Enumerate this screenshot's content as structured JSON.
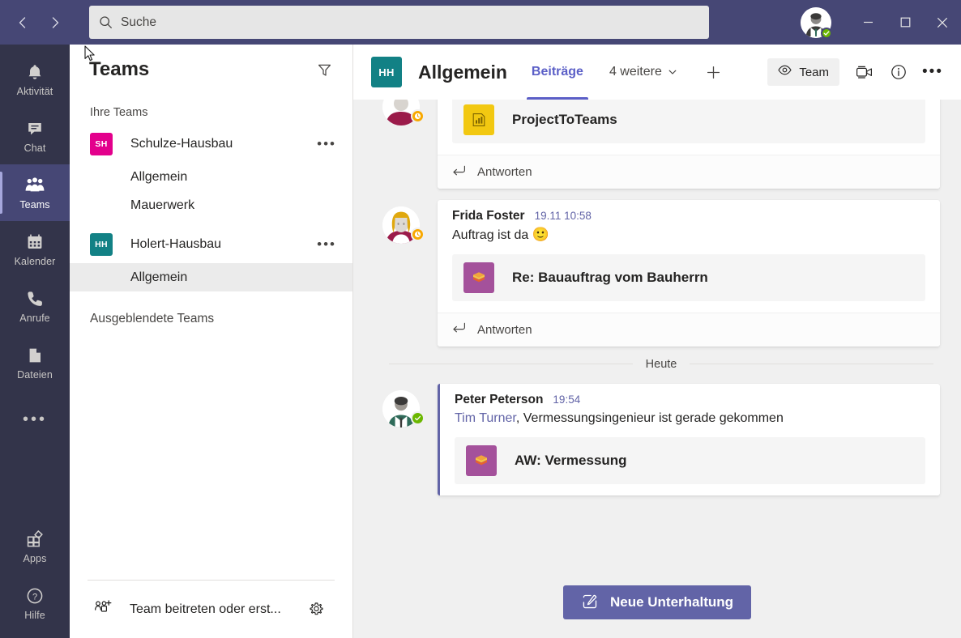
{
  "titlebar": {
    "back_label": "Zurück",
    "forward_label": "Vorwärts",
    "search_placeholder": "Suche",
    "search_value": "",
    "profile_status": "Verfügbar",
    "minimize_label": "Minimieren",
    "maximize_label": "Maximieren",
    "close_label": "Schließen"
  },
  "rail": {
    "items": [
      {
        "label": "Aktivität",
        "icon": "bell-icon",
        "active": false
      },
      {
        "label": "Chat",
        "icon": "chat-icon",
        "active": false
      },
      {
        "label": "Teams",
        "icon": "teams-icon",
        "active": true
      },
      {
        "label": "Kalender",
        "icon": "calendar-icon",
        "active": false
      },
      {
        "label": "Anrufe",
        "icon": "phone-icon",
        "active": false
      },
      {
        "label": "Dateien",
        "icon": "files-icon",
        "active": false
      }
    ],
    "more_label": "Mehr Apps",
    "apps_label": "Apps",
    "help_label": "Hilfe"
  },
  "teams_panel": {
    "title": "Teams",
    "filter_label": "Filtern",
    "your_teams_label": "Ihre Teams",
    "hidden_teams_label": "Ausgeblendete Teams",
    "teams": [
      {
        "name": "Schulze-Hausbau",
        "initials": "SH",
        "color": "#e3008c",
        "more_label": "Weitere Optionen",
        "channels": [
          {
            "name": "Allgemein",
            "selected": false
          },
          {
            "name": "Mauerwerk",
            "selected": false
          }
        ]
      },
      {
        "name": "Holert-Hausbau",
        "initials": "HH",
        "color": "#128185",
        "more_label": "Weitere Optionen",
        "channels": [
          {
            "name": "Allgemein",
            "selected": true
          }
        ]
      }
    ],
    "footer": {
      "join_label": "Team beitreten oder erst...",
      "settings_label": "Einstellungen"
    }
  },
  "channel": {
    "initials": "HH",
    "avatar_color": "#128185",
    "name": "Allgemein",
    "tabs": [
      {
        "label": "Beiträge",
        "active": true,
        "dropdown": false
      },
      {
        "label": "4 weitere",
        "active": false,
        "dropdown": true
      }
    ],
    "add_tab_label": "Registerkarte hinzufügen",
    "team_button_label": "Team",
    "meet_label": "Jetzt besprechen",
    "info_label": "Kanalinformationen",
    "more_label": "Weitere Optionen"
  },
  "messages": [
    {
      "author": "",
      "time": "",
      "text": "",
      "mention": "",
      "emoji": "",
      "avatar": "partial",
      "presence": "away",
      "unread": false,
      "partial": true,
      "attachment": {
        "name": "ProjectToTeams",
        "icon_color": "#f2c811",
        "icon_type": "chart-icon"
      },
      "reply_label": "Antworten"
    },
    {
      "author": "Frida Foster",
      "time": "19.11 10:58",
      "text": "Auftrag ist da",
      "mention": "",
      "emoji": "🙂",
      "avatar": "woman",
      "presence": "away",
      "unread": false,
      "partial": false,
      "attachment": {
        "name": "Re: Bauauftrag vom Bauherrn",
        "icon_color": "#a4519b",
        "icon_type": "mail-stack-icon"
      },
      "reply_label": "Antworten"
    },
    {
      "author": "Peter Peterson",
      "time": "19:54",
      "text": ", Vermessungsingenieur ist gerade gekommen",
      "mention": "Tim Turner",
      "emoji": "",
      "avatar": "man",
      "presence": "online",
      "unread": true,
      "partial": false,
      "attachment": {
        "name": "AW: Vermessung",
        "icon_color": "#a4519b",
        "icon_type": "mail-stack-icon"
      },
      "reply_label": ""
    }
  ],
  "day_divider_label": "Heute",
  "compose": {
    "new_conversation_label": "Neue Unterhaltung"
  },
  "colors": {
    "titlebar": "#464775",
    "rail": "#33344a",
    "accent": "#6264a7",
    "accent_text": "#5b5fc7",
    "canvas": "#f0f0f0"
  }
}
